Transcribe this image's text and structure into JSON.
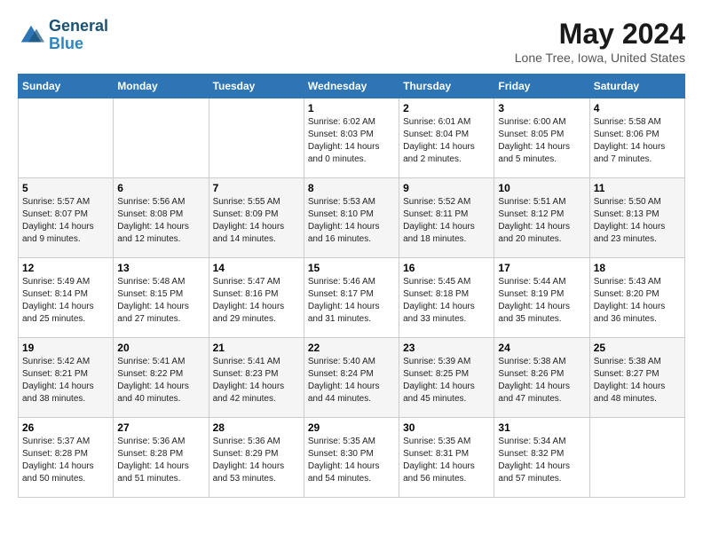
{
  "logo": {
    "line1": "General",
    "line2": "Blue"
  },
  "title": "May 2024",
  "subtitle": "Lone Tree, Iowa, United States",
  "days_of_week": [
    "Sunday",
    "Monday",
    "Tuesday",
    "Wednesday",
    "Thursday",
    "Friday",
    "Saturday"
  ],
  "weeks": [
    [
      {
        "day": "",
        "info": ""
      },
      {
        "day": "",
        "info": ""
      },
      {
        "day": "",
        "info": ""
      },
      {
        "day": "1",
        "info": "Sunrise: 6:02 AM\nSunset: 8:03 PM\nDaylight: 14 hours\nand 0 minutes."
      },
      {
        "day": "2",
        "info": "Sunrise: 6:01 AM\nSunset: 8:04 PM\nDaylight: 14 hours\nand 2 minutes."
      },
      {
        "day": "3",
        "info": "Sunrise: 6:00 AM\nSunset: 8:05 PM\nDaylight: 14 hours\nand 5 minutes."
      },
      {
        "day": "4",
        "info": "Sunrise: 5:58 AM\nSunset: 8:06 PM\nDaylight: 14 hours\nand 7 minutes."
      }
    ],
    [
      {
        "day": "5",
        "info": "Sunrise: 5:57 AM\nSunset: 8:07 PM\nDaylight: 14 hours\nand 9 minutes."
      },
      {
        "day": "6",
        "info": "Sunrise: 5:56 AM\nSunset: 8:08 PM\nDaylight: 14 hours\nand 12 minutes."
      },
      {
        "day": "7",
        "info": "Sunrise: 5:55 AM\nSunset: 8:09 PM\nDaylight: 14 hours\nand 14 minutes."
      },
      {
        "day": "8",
        "info": "Sunrise: 5:53 AM\nSunset: 8:10 PM\nDaylight: 14 hours\nand 16 minutes."
      },
      {
        "day": "9",
        "info": "Sunrise: 5:52 AM\nSunset: 8:11 PM\nDaylight: 14 hours\nand 18 minutes."
      },
      {
        "day": "10",
        "info": "Sunrise: 5:51 AM\nSunset: 8:12 PM\nDaylight: 14 hours\nand 20 minutes."
      },
      {
        "day": "11",
        "info": "Sunrise: 5:50 AM\nSunset: 8:13 PM\nDaylight: 14 hours\nand 23 minutes."
      }
    ],
    [
      {
        "day": "12",
        "info": "Sunrise: 5:49 AM\nSunset: 8:14 PM\nDaylight: 14 hours\nand 25 minutes."
      },
      {
        "day": "13",
        "info": "Sunrise: 5:48 AM\nSunset: 8:15 PM\nDaylight: 14 hours\nand 27 minutes."
      },
      {
        "day": "14",
        "info": "Sunrise: 5:47 AM\nSunset: 8:16 PM\nDaylight: 14 hours\nand 29 minutes."
      },
      {
        "day": "15",
        "info": "Sunrise: 5:46 AM\nSunset: 8:17 PM\nDaylight: 14 hours\nand 31 minutes."
      },
      {
        "day": "16",
        "info": "Sunrise: 5:45 AM\nSunset: 8:18 PM\nDaylight: 14 hours\nand 33 minutes."
      },
      {
        "day": "17",
        "info": "Sunrise: 5:44 AM\nSunset: 8:19 PM\nDaylight: 14 hours\nand 35 minutes."
      },
      {
        "day": "18",
        "info": "Sunrise: 5:43 AM\nSunset: 8:20 PM\nDaylight: 14 hours\nand 36 minutes."
      }
    ],
    [
      {
        "day": "19",
        "info": "Sunrise: 5:42 AM\nSunset: 8:21 PM\nDaylight: 14 hours\nand 38 minutes."
      },
      {
        "day": "20",
        "info": "Sunrise: 5:41 AM\nSunset: 8:22 PM\nDaylight: 14 hours\nand 40 minutes."
      },
      {
        "day": "21",
        "info": "Sunrise: 5:41 AM\nSunset: 8:23 PM\nDaylight: 14 hours\nand 42 minutes."
      },
      {
        "day": "22",
        "info": "Sunrise: 5:40 AM\nSunset: 8:24 PM\nDaylight: 14 hours\nand 44 minutes."
      },
      {
        "day": "23",
        "info": "Sunrise: 5:39 AM\nSunset: 8:25 PM\nDaylight: 14 hours\nand 45 minutes."
      },
      {
        "day": "24",
        "info": "Sunrise: 5:38 AM\nSunset: 8:26 PM\nDaylight: 14 hours\nand 47 minutes."
      },
      {
        "day": "25",
        "info": "Sunrise: 5:38 AM\nSunset: 8:27 PM\nDaylight: 14 hours\nand 48 minutes."
      }
    ],
    [
      {
        "day": "26",
        "info": "Sunrise: 5:37 AM\nSunset: 8:28 PM\nDaylight: 14 hours\nand 50 minutes."
      },
      {
        "day": "27",
        "info": "Sunrise: 5:36 AM\nSunset: 8:28 PM\nDaylight: 14 hours\nand 51 minutes."
      },
      {
        "day": "28",
        "info": "Sunrise: 5:36 AM\nSunset: 8:29 PM\nDaylight: 14 hours\nand 53 minutes."
      },
      {
        "day": "29",
        "info": "Sunrise: 5:35 AM\nSunset: 8:30 PM\nDaylight: 14 hours\nand 54 minutes."
      },
      {
        "day": "30",
        "info": "Sunrise: 5:35 AM\nSunset: 8:31 PM\nDaylight: 14 hours\nand 56 minutes."
      },
      {
        "day": "31",
        "info": "Sunrise: 5:34 AM\nSunset: 8:32 PM\nDaylight: 14 hours\nand 57 minutes."
      },
      {
        "day": "",
        "info": ""
      }
    ]
  ]
}
